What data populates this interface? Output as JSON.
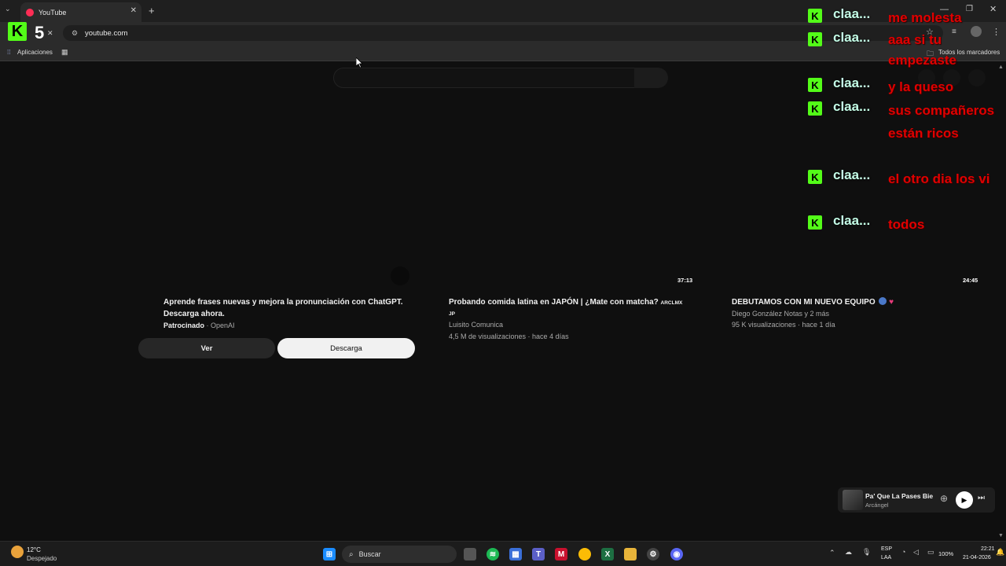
{
  "browser": {
    "tab_title": "YouTube",
    "url": "youtube.com",
    "bookmarks": {
      "apps_label": "Aplicaciones",
      "all_bookmarks": "Todos los marcadores"
    }
  },
  "kick_overlay": {
    "viewer_count": "5"
  },
  "ad": {
    "title_line1": "Aprende frases nuevas y mejora la pronunciación con ChatGPT.",
    "title_line2": "Descarga ahora.",
    "sponsored": "Patrocinado",
    "advertiser": "· OpenAI",
    "watch_button": "Ver",
    "download_button": "Descarga"
  },
  "videos": [
    {
      "duration": "37:13",
      "title": "Probando comida latina en JAPÓN | ¿Mate con matcha?",
      "title_tag": "ARCLMX",
      "title_tag2": "JP",
      "channel": "Luisito Comunica",
      "stats": "4,5 M de visualizaciones · hace 4 días"
    },
    {
      "duration": "24:45",
      "title": "DEBUTAMOS CON MI NUEVO EQUIPO",
      "channel": "Diego González Notas y 2 más",
      "stats": "95 K visualizaciones · hace 1 día"
    }
  ],
  "chat": [
    {
      "user": "claa...",
      "message": "me molesta"
    },
    {
      "user": "claa...",
      "message": "aaa si tu empezaste"
    },
    {
      "user": "claa...",
      "message": "y la queso"
    },
    {
      "user": "claa...",
      "message": "sus compañeros están ricos"
    },
    {
      "user": "claa...",
      "message": "el otro dia los vi"
    },
    {
      "user": "claa...",
      "message": "todos"
    }
  ],
  "mini_player": {
    "title": "Pa' Que La Pases Bie",
    "artist": "Arcángel"
  },
  "taskbar": {
    "weather_temp": "12°C",
    "weather_desc": "Despejado",
    "search_placeholder": "Buscar",
    "lang": "ESP",
    "lang_region": "LAA",
    "battery": "100%",
    "time": "22:21",
    "date": "21-04-2026"
  },
  "colors": {
    "kick_green": "#53fc18",
    "chat_red": "#e00000",
    "chat_user": "#c5ffe8"
  }
}
